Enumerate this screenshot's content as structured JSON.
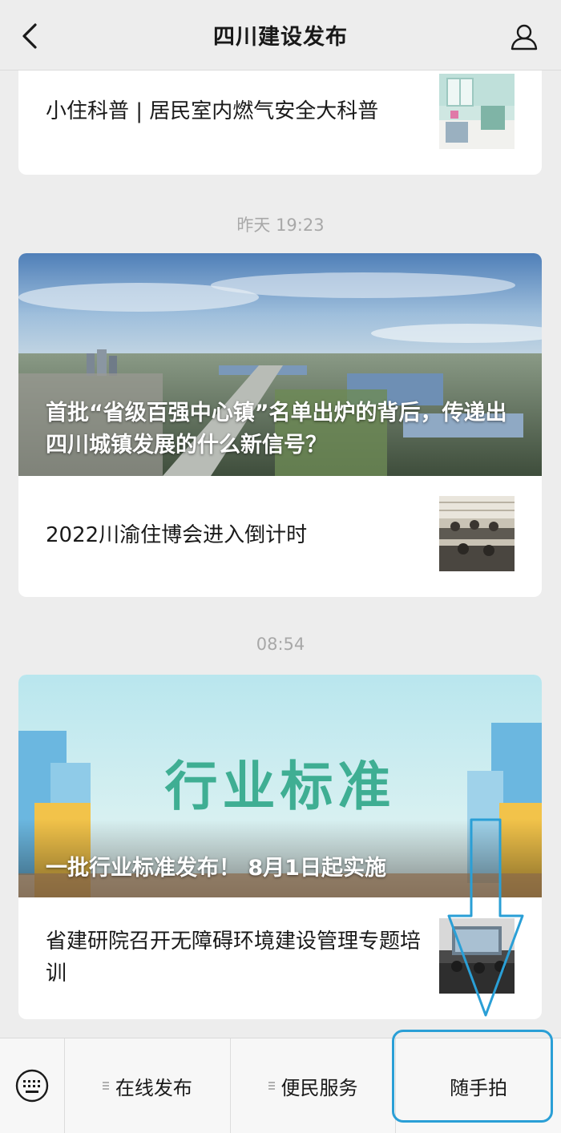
{
  "nav": {
    "title": "四川建设发布"
  },
  "articles_top": {
    "item1": "小住科普 | 居民室内燃气安全大科普"
  },
  "group1": {
    "time": "昨天 19:23",
    "hero_title": "首批“省级百强中心镇”名单出炉的背后，传递出四川城镇发展的什么新信号？",
    "item1": "2022川渝住博会进入倒计时"
  },
  "group2": {
    "time": "08:54",
    "hero_banner": "行业标准",
    "hero_title": "一批行业标准发布！ 8月1日起实施",
    "item1": "省建研院召开无障碍环境建设管理专题培训"
  },
  "menu": {
    "item1": "在线发布",
    "item2": "便民服务",
    "item3": "随手拍"
  },
  "colors": {
    "annotation": "#2a9fd6",
    "banner_text": "#3fae93"
  }
}
